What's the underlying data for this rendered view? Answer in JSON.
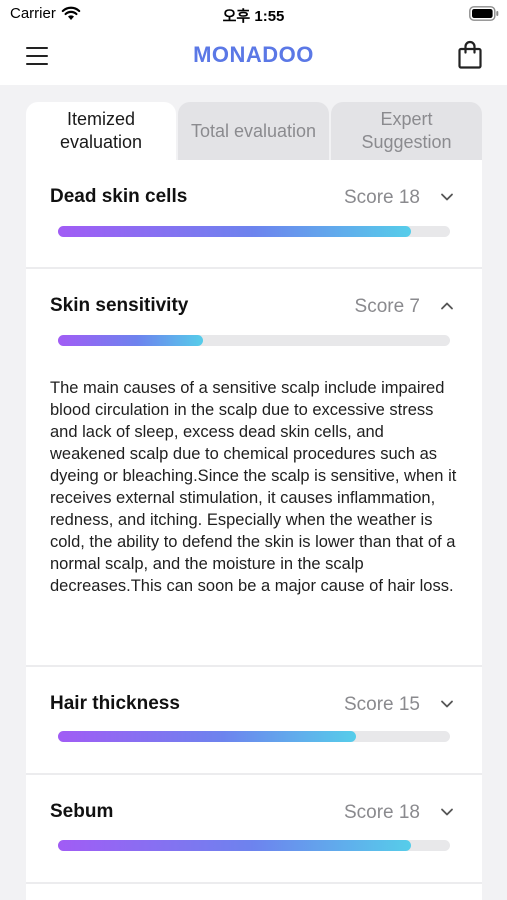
{
  "status_bar": {
    "carrier": "Carrier",
    "time": "오후 1:55"
  },
  "header": {
    "brand": "MONADOO",
    "menu_icon": "hamburger-menu-icon",
    "cart_icon": "shopping-bag-icon"
  },
  "tabs": [
    {
      "label": "Itemized evaluation",
      "active": true
    },
    {
      "label": "Total evaluation",
      "active": false
    },
    {
      "label": "Expert Suggestion",
      "active": false
    }
  ],
  "colors": {
    "brand": "#5b78e6",
    "bar_start": "#a15cf5",
    "bar_end": "#56cdea",
    "track": "#e8e8ea"
  },
  "items": [
    {
      "title": "Dead skin cells",
      "score": "Score 18",
      "score_value": 18,
      "level_fraction": 0.9,
      "expanded": false,
      "chevron": "chevron-down-icon"
    },
    {
      "title": "Skin sensitivity",
      "score": "Score 7",
      "score_value": 7,
      "level_fraction": 0.37,
      "expanded": true,
      "chevron": "chevron-up-icon",
      "description": "The main causes of a sensitive scalp include impaired blood circulation in the scalp due to excessive stress and lack of sleep, excess dead skin cells, and weakened scalp due to chemical procedures such as dyeing or bleaching.Since the scalp is sensitive, when it receives external stimulation, it causes inflammation, redness, and itching. Especially when the weather is cold, the ability to defend the skin is lower than that of a normal scalp, and the moisture in the scalp decreases.This can soon be a major cause of hair loss."
    },
    {
      "title": "Hair thickness",
      "score": "Score 15",
      "score_value": 15,
      "level_fraction": 0.76,
      "expanded": false,
      "chevron": "chevron-down-icon"
    },
    {
      "title": "Sebum",
      "score": "Score 18",
      "score_value": 18,
      "level_fraction": 0.9,
      "expanded": false,
      "chevron": "chevron-down-icon"
    }
  ]
}
